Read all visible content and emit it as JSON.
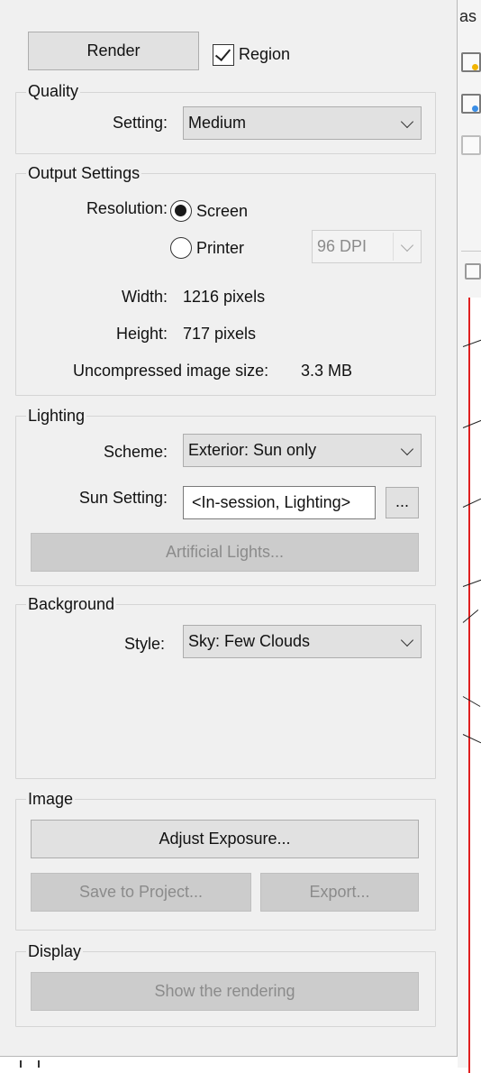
{
  "background_app": {
    "tab_text_fragment": "as"
  },
  "render_button": {
    "label": "Render"
  },
  "region_checkbox": {
    "label": "Region",
    "checked": true
  },
  "quality": {
    "legend": "Quality",
    "setting_label": "Setting:",
    "setting_value": "Medium"
  },
  "output": {
    "legend": "Output Settings",
    "resolution_label": "Resolution:",
    "screen_option": "Screen",
    "printer_option": "Printer",
    "selected": "Screen",
    "dpi_value": "96 DPI",
    "width_label": "Width:",
    "width_value": "1216 pixels",
    "height_label": "Height:",
    "height_value": "717 pixels",
    "size_label": "Uncompressed image size:",
    "size_value": "3.3 MB"
  },
  "lighting": {
    "legend": "Lighting",
    "scheme_label": "Scheme:",
    "scheme_value": "Exterior: Sun only",
    "sun_setting_label": "Sun Setting:",
    "sun_setting_value": "<In-session, Lighting>",
    "browse_button": "...",
    "artificial_lights_button": "Artificial Lights..."
  },
  "background": {
    "legend": "Background",
    "style_label": "Style:",
    "style_value": "Sky: Few Clouds"
  },
  "image": {
    "legend": "Image",
    "adjust_exposure_button": "Adjust Exposure...",
    "save_to_project_button": "Save to Project...",
    "export_button": "Export..."
  },
  "display": {
    "legend": "Display",
    "show_rendering_button": "Show the rendering"
  },
  "colors": {
    "panel_bg": "#f0f0f0",
    "button_bg": "#e1e1e1",
    "disabled_bg": "#cccccc",
    "disabled_text": "#8b8b8b",
    "canvas_border": "#e02020"
  }
}
